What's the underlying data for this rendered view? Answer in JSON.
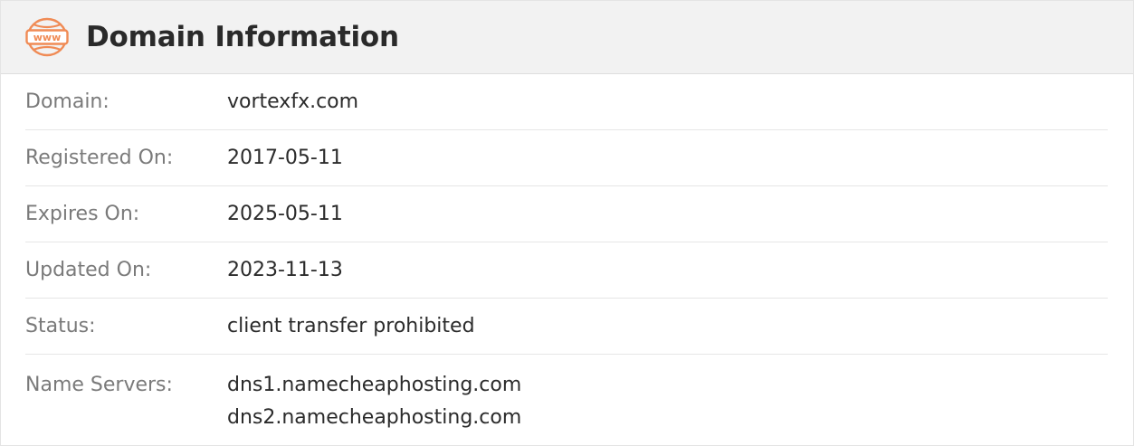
{
  "header": {
    "title": "Domain Information",
    "icon": "www-globe-icon",
    "icon_text": "www",
    "icon_color": "#f08b55"
  },
  "rows": {
    "domain": {
      "label": "Domain:",
      "value": "vortexfx.com"
    },
    "registered": {
      "label": "Registered On:",
      "value": "2017-05-11"
    },
    "expires": {
      "label": "Expires On:",
      "value": "2025-05-11"
    },
    "updated": {
      "label": "Updated On:",
      "value": "2023-11-13"
    },
    "status": {
      "label": "Status:",
      "value": "client transfer prohibited"
    },
    "name_servers": {
      "label": "Name Servers:",
      "values": [
        "dns1.namecheaphosting.com",
        "dns2.namecheaphosting.com"
      ]
    }
  }
}
